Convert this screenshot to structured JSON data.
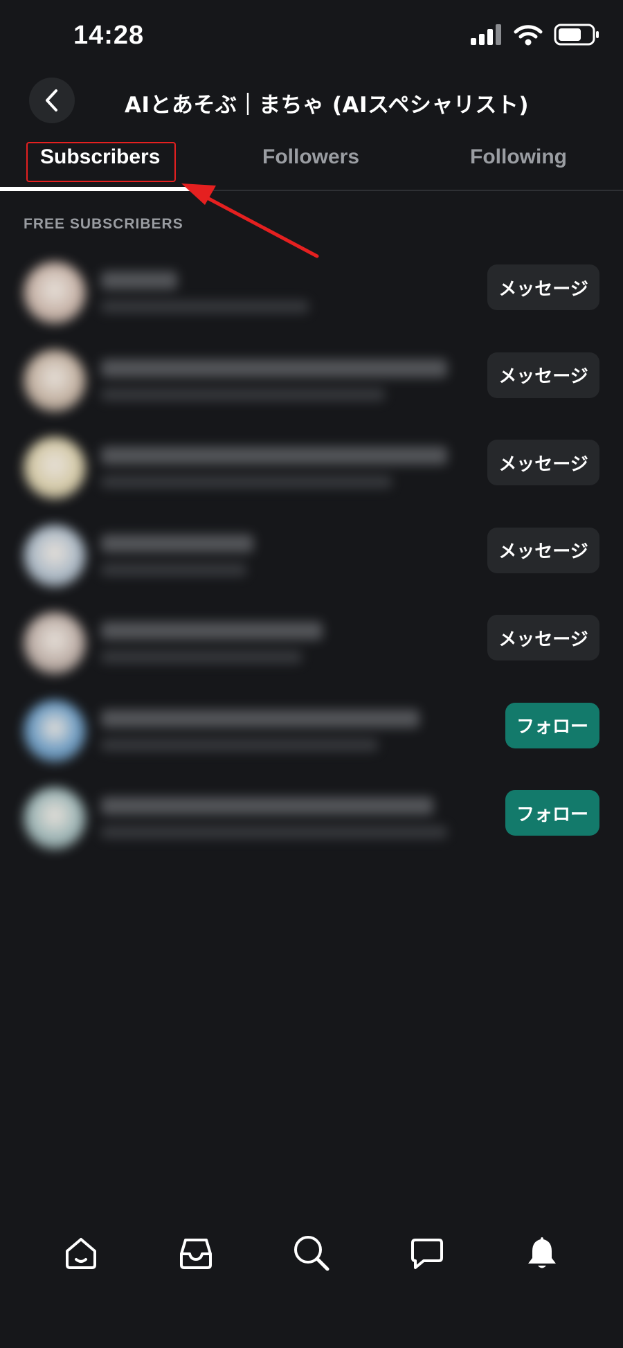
{
  "status_bar": {
    "time": "14:28"
  },
  "header": {
    "title": "AIとあそぶ｜まちゃ (AIスペシャリスト)"
  },
  "tabs": [
    {
      "label": "Subscribers",
      "active": true
    },
    {
      "label": "Followers",
      "active": false
    },
    {
      "label": "Following",
      "active": false
    }
  ],
  "section_label": "FREE SUBSCRIBERS",
  "subscribers": [
    {
      "action": "メッセージ",
      "type": "message",
      "avatar_color": "#d9c2b5"
    },
    {
      "action": "メッセージ",
      "type": "message",
      "avatar_color": "#d4c0ae"
    },
    {
      "action": "メッセージ",
      "type": "message",
      "avatar_color": "#e8dcb4"
    },
    {
      "action": "メッセージ",
      "type": "message",
      "avatar_color": "#b9c9d8"
    },
    {
      "action": "メッセージ",
      "type": "message",
      "avatar_color": "#cdbcb3"
    },
    {
      "action": "フォロー",
      "type": "follow",
      "avatar_color": "#6fa6d4"
    },
    {
      "action": "フォロー",
      "type": "follow",
      "avatar_color": "#a9c5c6"
    }
  ],
  "bottom_nav": [
    {
      "icon": "home-icon"
    },
    {
      "icon": "inbox-icon"
    },
    {
      "icon": "search-icon"
    },
    {
      "icon": "chat-icon"
    },
    {
      "icon": "bell-icon"
    }
  ],
  "colors": {
    "background": "#16171a",
    "follow_button": "#137a6b",
    "message_button": "#26282b",
    "annotation": "#e52020"
  }
}
